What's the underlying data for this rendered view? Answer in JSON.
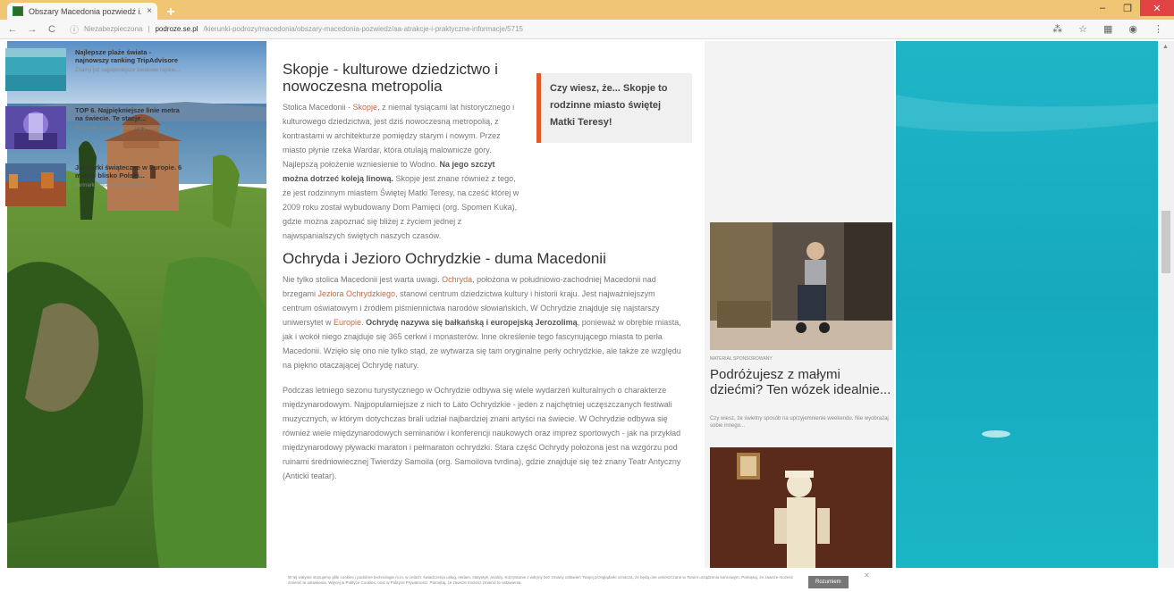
{
  "browser": {
    "tab_title": "Obszary Macedonia pozwiedź i...",
    "tab_close": "×",
    "new_tab": "+",
    "min": "–",
    "max": "❐",
    "close": "✕",
    "back": "←",
    "forward": "→",
    "reload": "C",
    "security": "Niezabezpieczona",
    "url_host": "podroze.se.pl",
    "url_path": "/kierunki-podrozy/macedonia/obszary-macedonia-pozwiedz/aa-atrakcje-i-praktyczne-informacje/5715"
  },
  "article": {
    "h1": "Skopje - kulturowe dziedzictwo i nowoczesna metropolia",
    "p1_pre": "Stolica Macedonii - ",
    "p1_link": "Skopje",
    "p1_post": ", z niemal tysiącami lat historycznego i kulturowego dziedzictwa, jest dziś nowoczesną metropolią, z kontrastami w architekturze pomiędzy starym i nowym. Przez miasto płynie rzeka Wardar, która otulają malownicze góry. Najlepszą położenie wzniesienie to Wodno. ",
    "p1_bold": "Na jego szczyt można dotrzeć koleją linową.",
    "p1_tail": " Skopje jest znane również z tego, że jest rodzinnym miastem Świętej Matki Teresy, na cześć której w 2009 roku został wybudowany Dom Pamięci (org. Spomen Kuka), gdzie można zapoznać się bliżej z życiem jednej z najwspanialszych świętych naszych czasów.",
    "h2": "Ochryda i Jezioro Ochrydzkie - duma Macedonii",
    "p2_a": "Nie tylko stolica Macedonii jest warta uwagi. ",
    "p2_link1": "Ochryda",
    "p2_b": ", położona w południowo-zachodniej Macedonii nad brzegami ",
    "p2_link2": "Jeziora Ochrydzkiego",
    "p2_c": ", stanowi centrum dziedzictwa kultury i historii kraju. Jest najważniejszym centrum oświatowym i źródłem piśmiennictwa narodów słowiańskich. W Ochrydzie znajduje się najstarszy uniwersytet w ",
    "p2_link3": "Europie",
    "p2_d": ". ",
    "p2_bold": "Ochrydę nazywa się bałkańską i europejską Jerozolimą",
    "p2_e": ", ponieważ w obrębie miasta, jak i wokół niego znajduje się 365 cerkwi i monasterów. Inne określenie tego fascynującego miasta to perła Macedonii. Wzięło się ono nie tylko stąd, że wytwarza się tam oryginalne perły ochrydzkie, ale także ze względu na piękno otaczającej Ochrydę natury.",
    "p3": "Podczas letniego sezonu turystycznego w Ochrydzie odbywa się wiele wydarzeń kulturalnych o charakterze międzynarodowym. Najpopularniejsze z nich to Lato Ochrydzkie - jeden z najchętniej uczęszczanych festiwali muzycznych, w którym dotychczas brali udział najbardziej znani artyści na świecie. W Ochrydzie odbywa się również wiele międzynarodowych seminariów i konferencji naukowych oraz imprez sportowych - jak na przykład międzynarodowy pływacki maraton i pełmaraton ochrydzki. Stara część Ochrydy położona jest na wzgórzu pod ruinami średniowiecznej Twierdzy Samoila (org. Samoilova tvrdina), gdzie znajduje się też znany Teatr Antyczny (Anticki teatar)."
  },
  "quote": {
    "text": "Czy wiesz, że... Skopje to rodzinne miasto świętej Matki Teresy!"
  },
  "sidebar": {
    "items": [
      {
        "title": "Najlepsze plaże świata - najnowszy ranking TripAdvisore",
        "desc": "Znamy już najpiękniejsze światowe rajskie..."
      },
      {
        "title": "TOP 6. Najpiękniejsze linie metra na świecie. Te stacje...",
        "desc": "Kolorowe, sztuka i pełnia na pewnych..."
      },
      {
        "title": "Jarmarki świąteczne w Europie. 6 miejsc blisko Polski...",
        "desc": "Jarmarki świąteczne w Europie ..."
      }
    ],
    "promo_tag": "MATERIAŁ SPONSOROWANY",
    "promo_title": "Podróżujesz z małymi dziećmi? Ten wózek idealnie...",
    "promo_desc": "Czy wiesz, że świetny sposób na uprzyjemnienie weekendu. Nie wyobrażaj sobie innego..."
  },
  "cookie": {
    "text": "W tej witrynie stosujemy pliki cookies i podobne technologie m.in. w celach: świadczenia usług, reklam, statystyk, analizy. Korzystanie z witryny bez zmiany ustawień Twojej przeglądarki oznacza, że będą one umieszczane w Twoim urządzeniu końcowym. Pamiętaj, że zawsze możesz zmienić te ustawienia. Więcej w Polityce Cookies, oraz w Polityce Prywatności. Pamiętaj, że zawsze możesz zmienić te ustawienia.",
    "button": "Rozumiem",
    "close": "✕"
  }
}
